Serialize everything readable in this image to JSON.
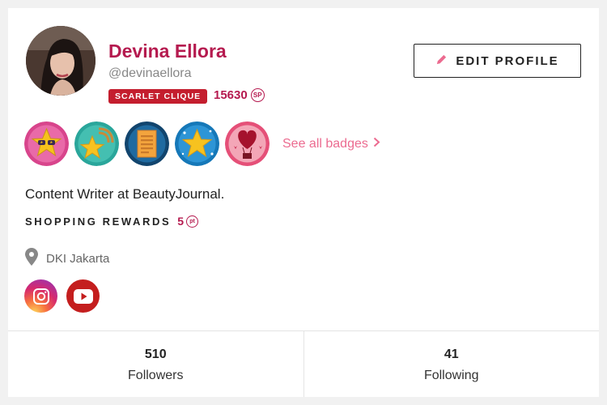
{
  "profile": {
    "name": "Devina Ellora",
    "handle": "@devinaellora",
    "clique_label": "SCARLET CLIQUE",
    "points": "15630",
    "points_unit": "SP",
    "bio": "Content Writer at BeautyJournal.",
    "location": "DKI Jakarta"
  },
  "actions": {
    "edit_profile": "EDIT PROFILE"
  },
  "badges": {
    "items": [
      {
        "icon": "star-sunglasses-badge-icon"
      },
      {
        "icon": "star-signal-badge-icon"
      },
      {
        "icon": "receipt-badge-icon"
      },
      {
        "icon": "star-sparkle-badge-icon"
      },
      {
        "icon": "heart-balloon-badge-icon"
      }
    ],
    "see_all": "See all badges"
  },
  "rewards": {
    "label": "SHOPPING REWARDS",
    "value": "5",
    "unit": "pt"
  },
  "socials": [
    {
      "icon": "instagram-icon"
    },
    {
      "icon": "youtube-icon"
    }
  ],
  "stats": {
    "followers_count": "510",
    "followers_label": "Followers",
    "following_count": "41",
    "following_label": "Following"
  },
  "colors": {
    "brand": "#b51a4f",
    "clique": "#c41e2e",
    "link": "#ec6b90"
  }
}
